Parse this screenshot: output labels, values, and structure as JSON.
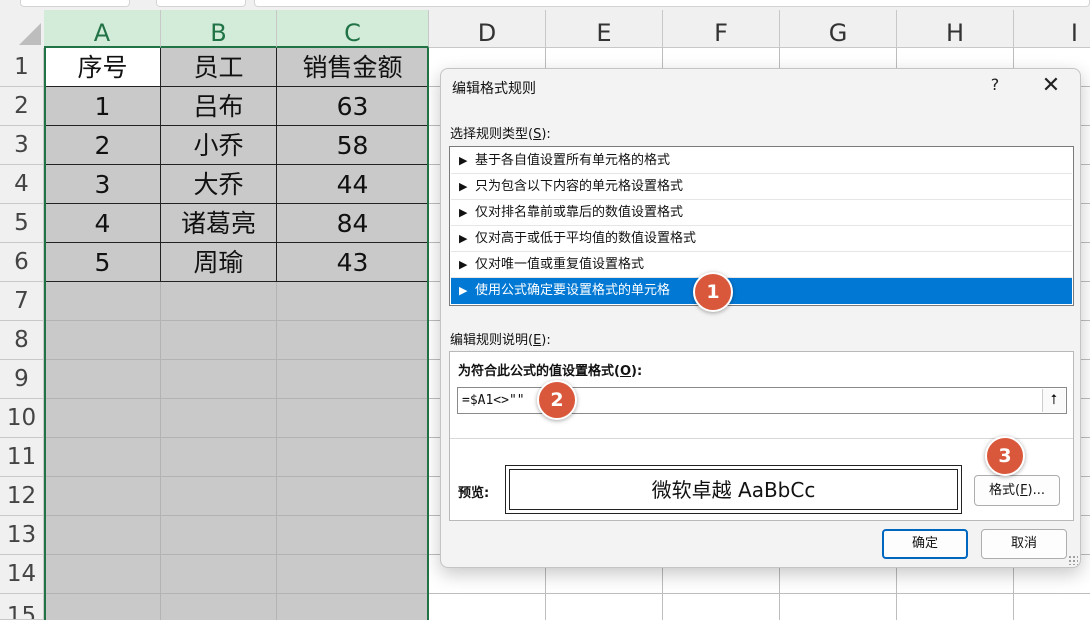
{
  "sheet": {
    "columns": [
      "A",
      "B",
      "C",
      "D",
      "E",
      "F",
      "G",
      "H",
      "I"
    ],
    "selected_columns": [
      "A",
      "B",
      "C"
    ],
    "rows": [
      "1",
      "2",
      "3",
      "4",
      "5",
      "6",
      "7",
      "8",
      "9",
      "10",
      "11",
      "12",
      "13",
      "14",
      "15"
    ],
    "table": {
      "headers": [
        "序号",
        "员工",
        "销售金额"
      ],
      "rows": [
        [
          "1",
          "吕布",
          "63"
        ],
        [
          "2",
          "小乔",
          "58"
        ],
        [
          "3",
          "大乔",
          "44"
        ],
        [
          "4",
          "诸葛亮",
          "84"
        ],
        [
          "5",
          "周瑜",
          "43"
        ]
      ]
    },
    "selection_color": "#217346"
  },
  "dialog": {
    "title": "编辑格式规则",
    "help": "?",
    "close": "✕",
    "rule_type_label_pre": "选择规则类型(",
    "rule_type_label_key": "S",
    "rule_type_label_post": "):",
    "rule_types": [
      "基于各自值设置所有单元格的格式",
      "只为包含以下内容的单元格设置格式",
      "仅对排名靠前或靠后的数值设置格式",
      "仅对高于或低于平均值的数值设置格式",
      "仅对唯一值或重复值设置格式",
      "使用公式确定要设置格式的单元格"
    ],
    "selected_rule_index": 5,
    "rule_arrow": "▶",
    "description_label_pre": "编辑规则说明(",
    "description_label_key": "E",
    "description_label_post": "):",
    "formula_label_pre": "为符合此公式的值设置格式(",
    "formula_label_key": "O",
    "formula_label_post": "):",
    "formula_value": "=$A1<>\"\"",
    "collapse_icon": "⭡",
    "preview_label": "预览:",
    "preview_text": "微软卓越  AaBbCc",
    "format_button_pre": "格式(",
    "format_button_key": "F",
    "format_button_post": ")...",
    "ok_button": "确定",
    "cancel_button": "取消",
    "accent_color": "#0078d4"
  },
  "annotations": [
    "1",
    "2",
    "3"
  ],
  "annotation_color": "#d9573b"
}
